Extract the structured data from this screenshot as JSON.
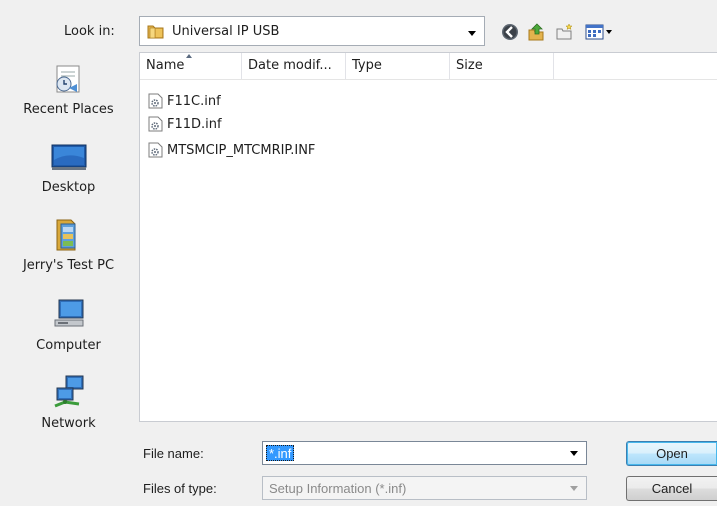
{
  "lookin": {
    "label": "Look in:",
    "value": "Universal IP USB"
  },
  "toolbar": {
    "icons": [
      "back-icon",
      "up-folder-icon",
      "new-folder-icon",
      "view-menu-icon"
    ]
  },
  "places": [
    {
      "label": "Recent Places",
      "icon": "recent-places-icon"
    },
    {
      "label": "Desktop",
      "icon": "desktop-icon"
    },
    {
      "label": "Jerry's Test PC",
      "icon": "user-folder-icon"
    },
    {
      "label": "Computer",
      "icon": "computer-icon"
    },
    {
      "label": "Network",
      "icon": "network-icon"
    }
  ],
  "columns": {
    "name": "Name",
    "date": "Date modif...",
    "type": "Type",
    "size": "Size"
  },
  "files": [
    {
      "name": "F11C.inf",
      "icon": "setup-info-file-icon"
    },
    {
      "name": "F11D.inf",
      "icon": "setup-info-file-icon"
    },
    {
      "name": "MTSMCIP_MTCMRIP.INF",
      "icon": "setup-info-file-icon"
    }
  ],
  "filename": {
    "label": "File name:",
    "value": "*.inf"
  },
  "filetype": {
    "label": "Files of type:",
    "value": "Setup Information (*.inf)"
  },
  "buttons": {
    "open": "Open",
    "cancel": "Cancel"
  },
  "colors": {
    "dialog_bg": "#f0f0f0",
    "selection": "#3399ff",
    "default_button_border": "#3c7fb1"
  }
}
